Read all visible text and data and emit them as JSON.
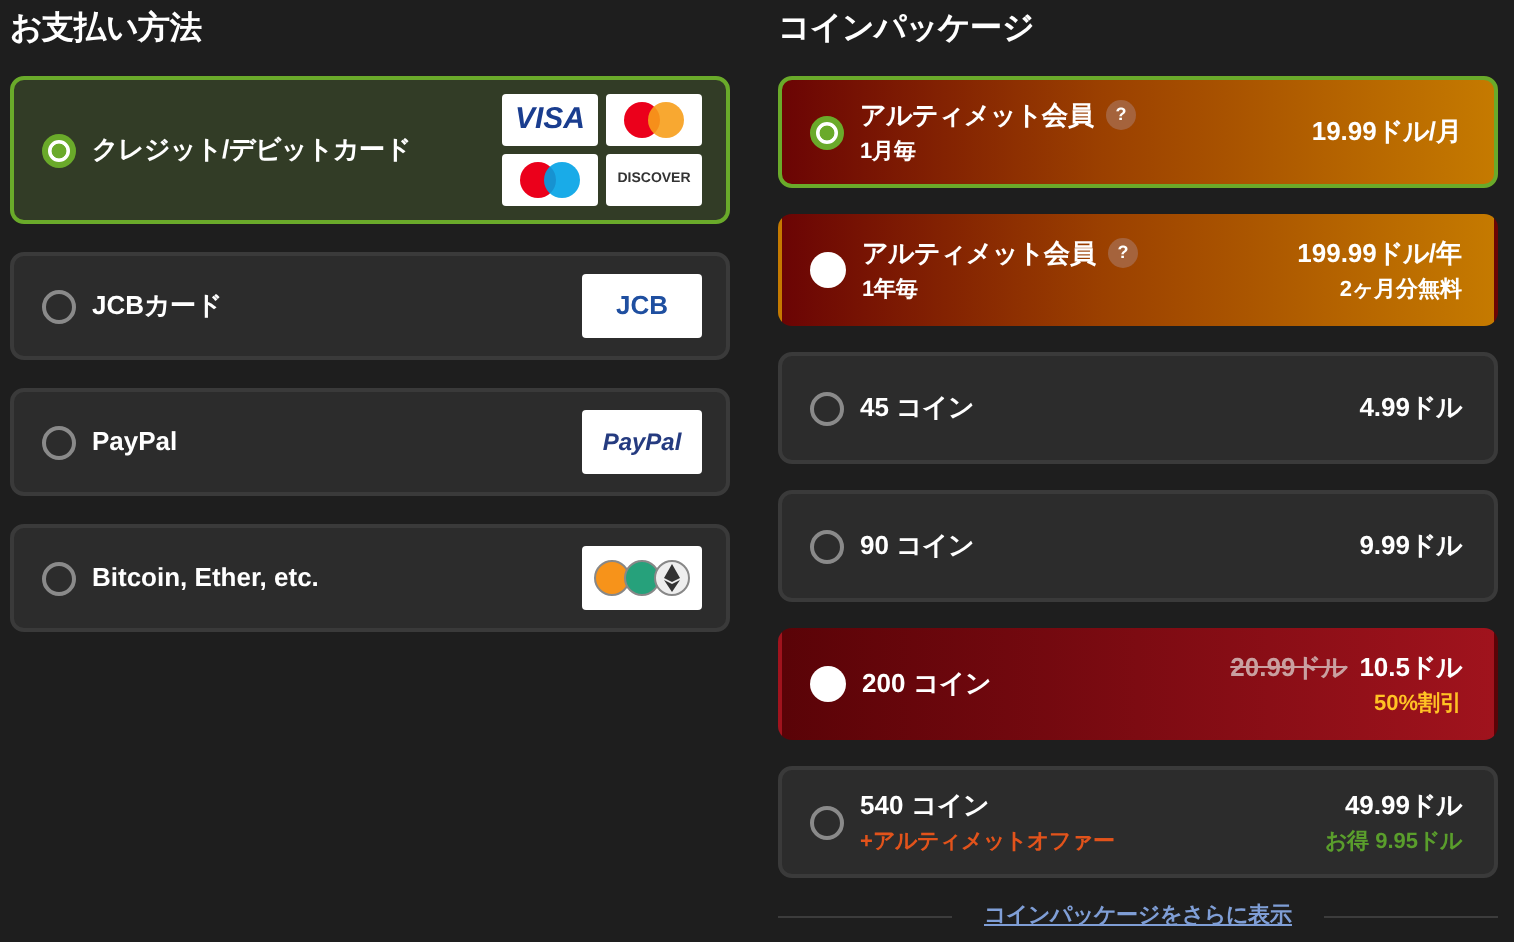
{
  "payment": {
    "title": "お支払い方法",
    "methods": [
      {
        "label": "クレジット/デビットカード",
        "selected": true,
        "logos": [
          {
            "kind": "visa",
            "label": "VISA"
          },
          {
            "kind": "mastercard"
          },
          {
            "kind": "maestro"
          },
          {
            "kind": "discover",
            "label": "DISCOVER"
          }
        ]
      },
      {
        "label": "JCBカード",
        "selected": false,
        "logos": [
          {
            "kind": "jcb",
            "label": "JCB"
          }
        ]
      },
      {
        "label": "PayPal",
        "selected": false,
        "logos": [
          {
            "kind": "paypal",
            "label": "PayPal"
          }
        ]
      },
      {
        "label": "Bitcoin, Ether, etc.",
        "selected": false,
        "logos": [
          {
            "kind": "crypto"
          }
        ]
      }
    ]
  },
  "packages": {
    "title": "コインパッケージ",
    "items": [
      {
        "kind": "gold",
        "name": "アルティメット会員",
        "help": "?",
        "sub": "1月毎",
        "price": "19.99ドル/月",
        "selected": true
      },
      {
        "kind": "gold",
        "name": "アルティメット会員",
        "help": "?",
        "sub": "1年毎",
        "price": "199.99ドル/年",
        "note": "2ヶ月分無料",
        "selected": false
      },
      {
        "kind": "plain",
        "name": "45 コイン",
        "price": "4.99ドル",
        "selected": false
      },
      {
        "kind": "plain",
        "name": "90 コイン",
        "price": "9.99ドル",
        "selected": false
      },
      {
        "kind": "red",
        "name": "200 コイン",
        "old_price": "20.99ドル",
        "price": "10.5ドル",
        "note": "50%割引",
        "selected": false
      },
      {
        "kind": "plain",
        "name": "540 コイン",
        "offer": "+アルティメットオファー",
        "price": "49.99ドル",
        "saving": "お得 9.95ドル",
        "selected": false
      }
    ],
    "more_link": "コインパッケージをさらに表示"
  }
}
